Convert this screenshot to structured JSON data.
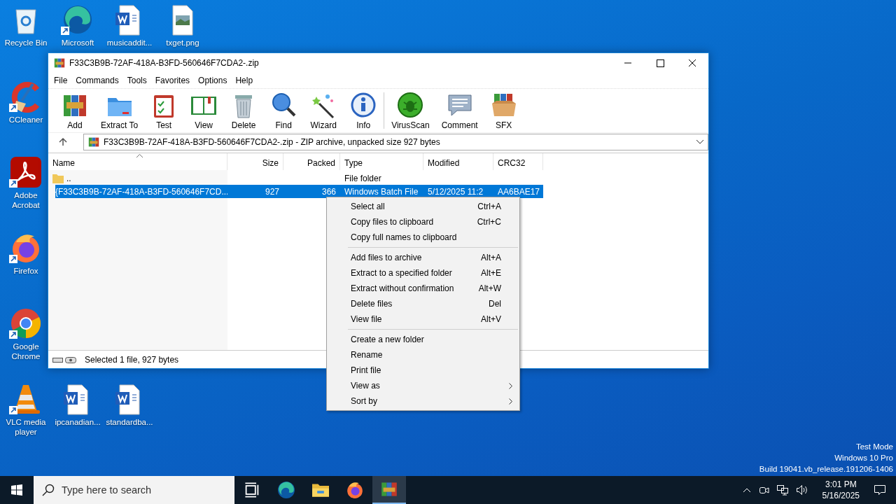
{
  "desktop_icons": [
    {
      "label": "Recycle Bin",
      "kind": "recycle",
      "shortcut": false
    },
    {
      "label": "Microsoft",
      "kind": "edge",
      "shortcut": true
    },
    {
      "label": "musicaddit...",
      "kind": "word",
      "shortcut": false
    },
    {
      "label": "txget.png",
      "kind": "image",
      "shortcut": false
    },
    {
      "label": "CCleaner",
      "kind": "ccleaner",
      "shortcut": true
    },
    {
      "label": "Adobe Acrobat",
      "kind": "acrobat",
      "shortcut": true
    },
    {
      "label": "Firefox",
      "kind": "firefox",
      "shortcut": true
    },
    {
      "label": "Google Chrome",
      "kind": "chrome",
      "shortcut": true
    },
    {
      "label": "VLC media player",
      "kind": "vlc",
      "shortcut": true
    },
    {
      "label": "ipcanadian...",
      "kind": "word",
      "shortcut": false
    },
    {
      "label": "standardba...",
      "kind": "word",
      "shortcut": false
    }
  ],
  "window": {
    "title": "F33C3B9B-72AF-418A-B3FD-560646F7CDA2-.zip",
    "menu": [
      "File",
      "Commands",
      "Tools",
      "Favorites",
      "Options",
      "Help"
    ],
    "toolbar": [
      {
        "label": "Add",
        "kind": "add"
      },
      {
        "label": "Extract To",
        "kind": "extract"
      },
      {
        "label": "Test",
        "kind": "test"
      },
      {
        "label": "View",
        "kind": "view"
      },
      {
        "label": "Delete",
        "kind": "delete"
      },
      {
        "label": "Find",
        "kind": "find"
      },
      {
        "label": "Wizard",
        "kind": "wizard"
      },
      {
        "label": "Info",
        "kind": "info"
      },
      {
        "label": "VirusScan",
        "kind": "virus"
      },
      {
        "label": "Comment",
        "kind": "comment"
      },
      {
        "label": "SFX",
        "kind": "sfx"
      }
    ],
    "address": "F33C3B9B-72AF-418A-B3FD-560646F7CDA2-.zip - ZIP archive, unpacked size 927 bytes",
    "columns": [
      "Name",
      "Size",
      "Packed",
      "Type",
      "Modified",
      "CRC32"
    ],
    "rows": [
      {
        "kind": "folder",
        "name": "..",
        "size": "",
        "packed": "",
        "type": "File folder",
        "modified": "",
        "crc": "",
        "selected": false
      },
      {
        "kind": "file",
        "name": "{F33C3B9B-72AF-418A-B3FD-560646F7CD...",
        "size": "927",
        "packed": "366",
        "type": "Windows Batch File",
        "modified": "5/12/2025 11:2",
        "crc": "AA6BAE17",
        "selected": true
      }
    ],
    "status": "Selected 1 file, 927 bytes"
  },
  "context_menu": [
    [
      {
        "label": "Select all",
        "shortcut": "Ctrl+A",
        "submenu": false
      },
      {
        "label": "Copy files to clipboard",
        "shortcut": "Ctrl+C",
        "submenu": false
      },
      {
        "label": "Copy full names to clipboard",
        "submenu": false
      }
    ],
    [
      {
        "label": "Add files to archive",
        "shortcut": "Alt+A",
        "submenu": false
      },
      {
        "label": "Extract to a specified folder",
        "shortcut": "Alt+E",
        "submenu": false
      },
      {
        "label": "Extract without confirmation",
        "shortcut": "Alt+W",
        "submenu": false
      },
      {
        "label": "Delete files",
        "shortcut": "Del",
        "submenu": false
      },
      {
        "label": "View file",
        "shortcut": "Alt+V",
        "submenu": false
      }
    ],
    [
      {
        "label": "Create a new folder",
        "submenu": false
      },
      {
        "label": "Rename",
        "submenu": false
      },
      {
        "label": "Print file",
        "submenu": false
      },
      {
        "label": "View as",
        "submenu": true
      },
      {
        "label": "Sort by",
        "submenu": true
      }
    ]
  ],
  "system_info": [
    "Test Mode",
    "Windows 10 Pro",
    "Build 19041.vb_release.191206-1406"
  ],
  "taskbar": {
    "search": {
      "placeholder": "Type here to search"
    },
    "apps": [
      {
        "kind": "taskview",
        "active": false
      },
      {
        "kind": "edge",
        "active": false
      },
      {
        "kind": "explorer",
        "active": false
      },
      {
        "kind": "firefox",
        "active": false
      },
      {
        "kind": "winrar",
        "active": true
      }
    ],
    "time": "3:01 PM",
    "date": "5/16/2025"
  }
}
